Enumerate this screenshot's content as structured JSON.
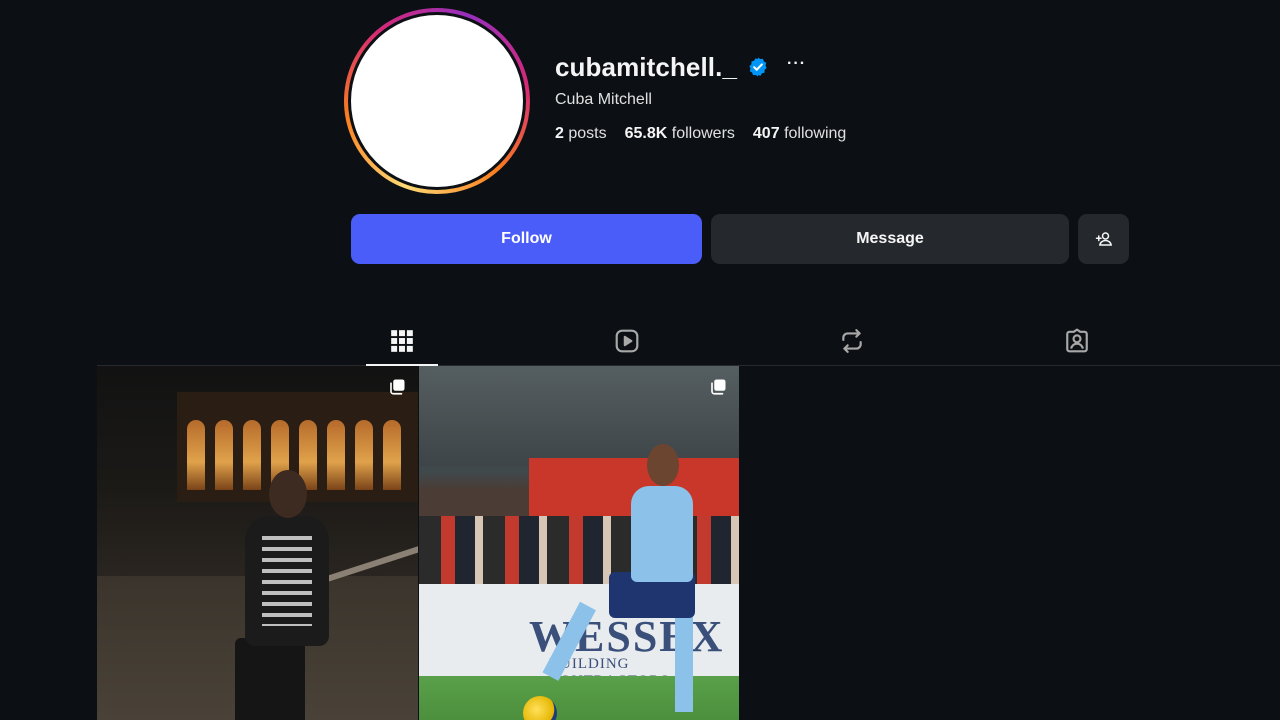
{
  "profile": {
    "username": "cubamitchell._",
    "full_name": "Cuba Mitchell",
    "verified": true,
    "stats": {
      "posts_count": "2",
      "posts_label": "posts",
      "followers_count": "65.8K",
      "followers_label": "followers",
      "following_count": "407",
      "following_label": "following"
    }
  },
  "actions": {
    "follow_label": "Follow",
    "message_label": "Message",
    "more_label": "···"
  },
  "tabs": [
    {
      "icon": "grid-icon",
      "active": true
    },
    {
      "icon": "reels-icon",
      "active": false
    },
    {
      "icon": "reposts-icon",
      "active": false
    },
    {
      "icon": "tagged-icon",
      "active": false
    }
  ],
  "posts": [
    {
      "multi_image": true,
      "board_text": ""
    },
    {
      "multi_image": true,
      "board_text": "WESSEX",
      "board_sub": "BUILDING CONTRACTORS"
    }
  ],
  "colors": {
    "background": "#0c1014",
    "follow_button": "#4a5df9",
    "secondary_button": "#25292e",
    "verified_badge": "#0095f6"
  }
}
